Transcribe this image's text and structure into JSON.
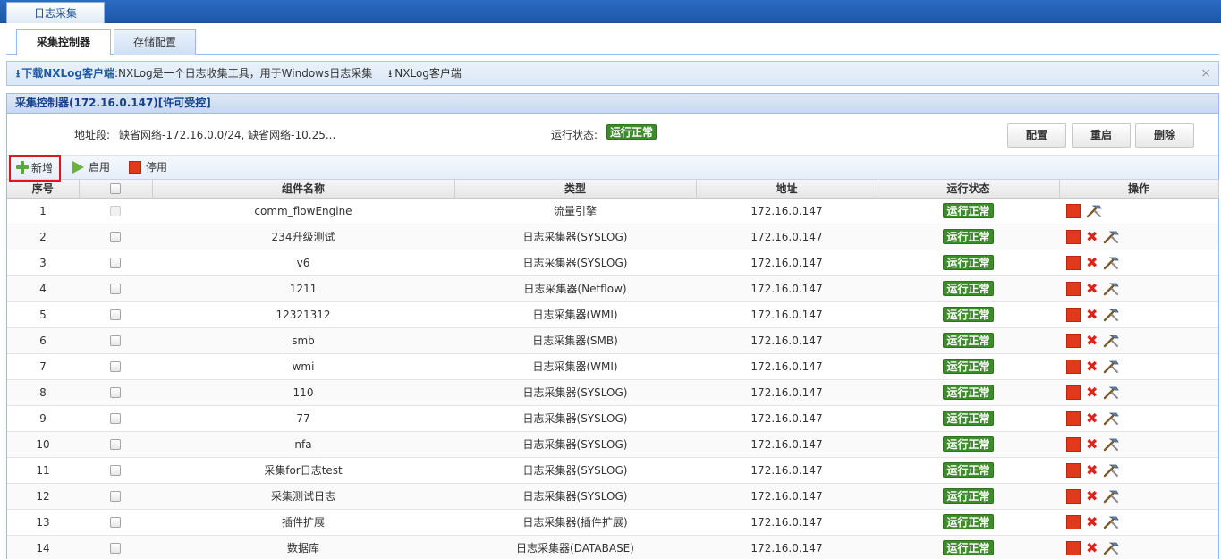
{
  "top_tab": "日志采集",
  "sub_tabs": [
    "采集控制器",
    "存储配置"
  ],
  "info_bar": {
    "download_label": "下载NXLog客户端",
    "download_desc": ":NXLog是一个日志收集工具，用于Windows日志采集",
    "client_link": "NXLog客户端",
    "close": "×"
  },
  "panel": {
    "title": "采集控制器(172.16.0.147)[许可受控]",
    "address_label": "地址段:",
    "address_value": "缺省网络-172.16.0.0/24, 缺省网络-10.25...",
    "status_label": "运行状态:",
    "status_value": "运行正常",
    "buttons": {
      "config": "配置",
      "restart": "重启",
      "delete": "删除"
    }
  },
  "toolbar": {
    "add": "新增",
    "enable": "启用",
    "disable": "停用"
  },
  "table": {
    "columns": [
      "序号",
      "",
      "组件名称",
      "类型",
      "地址",
      "运行状态",
      "操作"
    ],
    "rows": [
      {
        "no": "1",
        "name": "comm_flowEngine",
        "type": "流量引擎",
        "addr": "172.16.0.147",
        "status": "运行正常"
      },
      {
        "no": "2",
        "name": "234升级测试",
        "type": "日志采集器(SYSLOG)",
        "addr": "172.16.0.147",
        "status": "运行正常"
      },
      {
        "no": "3",
        "name": "v6",
        "type": "日志采集器(SYSLOG)",
        "addr": "172.16.0.147",
        "status": "运行正常"
      },
      {
        "no": "4",
        "name": "1211",
        "type": "日志采集器(Netflow)",
        "addr": "172.16.0.147",
        "status": "运行正常"
      },
      {
        "no": "5",
        "name": "12321312",
        "type": "日志采集器(WMI)",
        "addr": "172.16.0.147",
        "status": "运行正常"
      },
      {
        "no": "6",
        "name": "smb",
        "type": "日志采集器(SMB)",
        "addr": "172.16.0.147",
        "status": "运行正常"
      },
      {
        "no": "7",
        "name": "wmi",
        "type": "日志采集器(WMI)",
        "addr": "172.16.0.147",
        "status": "运行正常"
      },
      {
        "no": "8",
        "name": "110",
        "type": "日志采集器(SYSLOG)",
        "addr": "172.16.0.147",
        "status": "运行正常"
      },
      {
        "no": "9",
        "name": "77",
        "type": "日志采集器(SYSLOG)",
        "addr": "172.16.0.147",
        "status": "运行正常"
      },
      {
        "no": "10",
        "name": "nfa",
        "type": "日志采集器(SYSLOG)",
        "addr": "172.16.0.147",
        "status": "运行正常"
      },
      {
        "no": "11",
        "name": "采集for日志test",
        "type": "日志采集器(SYSLOG)",
        "addr": "172.16.0.147",
        "status": "运行正常"
      },
      {
        "no": "12",
        "name": "采集测试日志",
        "type": "日志采集器(SYSLOG)",
        "addr": "172.16.0.147",
        "status": "运行正常"
      },
      {
        "no": "13",
        "name": "插件扩展",
        "type": "日志采集器(插件扩展)",
        "addr": "172.16.0.147",
        "status": "运行正常"
      },
      {
        "no": "14",
        "name": "数据库",
        "type": "日志采集器(DATABASE)",
        "addr": "172.16.0.147",
        "status": "运行正常"
      }
    ]
  },
  "colors": {
    "header_blue": "#1c57a8",
    "status_green": "#3d8c2a",
    "stop_red": "#e0391c",
    "highlight_red": "#e0141b"
  }
}
